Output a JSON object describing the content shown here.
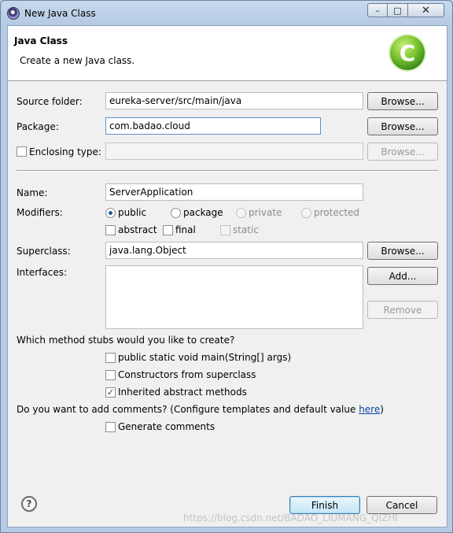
{
  "window": {
    "title": "New Java Class",
    "minimize_glyph": "–",
    "maximize_glyph": "□",
    "close_glyph": "✕"
  },
  "banner": {
    "title": "Java Class",
    "description": "Create a new Java class.",
    "icon_letter": "C"
  },
  "form": {
    "source_folder": {
      "label": "Source folder:",
      "value": "eureka-server/src/main/java",
      "button": "Browse..."
    },
    "package": {
      "label": "Package:",
      "value": "com.badao.cloud",
      "button": "Browse..."
    },
    "enclosing_type": {
      "label": "Enclosing type:",
      "value": "",
      "checked": false,
      "button": "Browse..."
    },
    "name": {
      "label": "Name:",
      "value": "ServerApplication"
    },
    "modifiers": {
      "label": "Modifiers:",
      "radios": [
        {
          "label": "public",
          "checked": true,
          "enabled": true
        },
        {
          "label": "package",
          "checked": false,
          "enabled": true
        },
        {
          "label": "private",
          "checked": false,
          "enabled": false
        },
        {
          "label": "protected",
          "checked": false,
          "enabled": false
        }
      ],
      "checkboxes": [
        {
          "label": "abstract",
          "checked": false,
          "enabled": true
        },
        {
          "label": "final",
          "checked": false,
          "enabled": true
        },
        {
          "label": "static",
          "checked": false,
          "enabled": false
        }
      ]
    },
    "superclass": {
      "label": "Superclass:",
      "value": "java.lang.Object",
      "button": "Browse..."
    },
    "interfaces": {
      "label": "Interfaces:",
      "add_button": "Add...",
      "remove_button": "Remove"
    }
  },
  "stubs": {
    "question": "Which method stubs would you like to create?",
    "options": [
      {
        "label": "public static void main(String[] args)",
        "checked": false
      },
      {
        "label": "Constructors from superclass",
        "checked": false
      },
      {
        "label": "Inherited abstract methods",
        "checked": true
      }
    ]
  },
  "comments": {
    "question_prefix": "Do you want to add comments? (Configure templates and default value ",
    "link": "here",
    "question_suffix": ")",
    "option": {
      "label": "Generate comments",
      "checked": false
    }
  },
  "footer": {
    "help_glyph": "?",
    "finish": "Finish",
    "cancel": "Cancel"
  },
  "watermark": "https://blog.csdn.net/BADAO_LIUMANG_QIZHI",
  "check_glyph": "✓"
}
